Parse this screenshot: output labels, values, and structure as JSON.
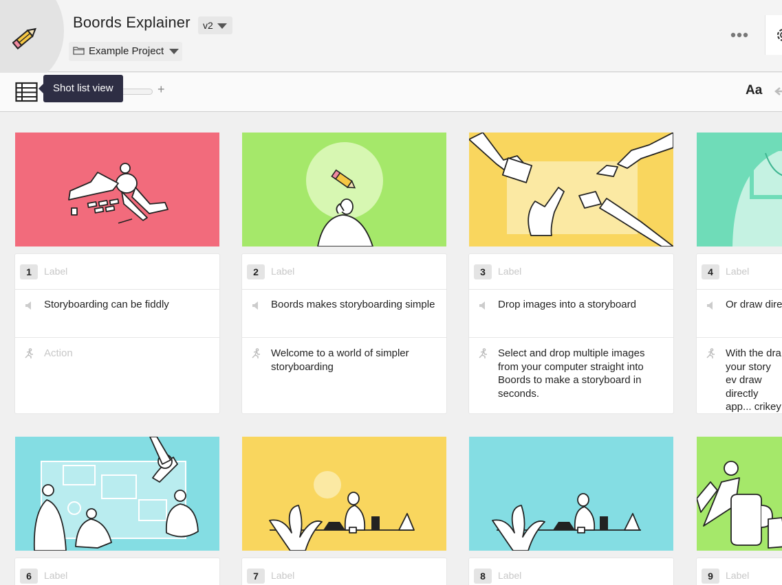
{
  "app": {
    "title": "Boords Explainer",
    "version": "v2",
    "project": "Example Project"
  },
  "toolbar": {
    "tooltip": "Shot list view",
    "zoom_plus": "+",
    "font_button": "Aa"
  },
  "colors": {
    "coral": "#f26b7c",
    "lime": "#a5e86a",
    "yellow": "#f9d65e",
    "mint": "#6fdcb8",
    "sky": "#84dde3",
    "tooltip_bg": "#2e2e44"
  },
  "frames": [
    {
      "number": "1",
      "label": "Label",
      "dialogue": "Storyboarding can be fiddly",
      "action": "Action",
      "action_placeholder": true,
      "color": "#f26b7c"
    },
    {
      "number": "2",
      "label": "Label",
      "dialogue": "Boords makes storyboarding simple",
      "action": "Welcome to a world of simpler storyboarding",
      "action_placeholder": false,
      "color": "#a5e86a"
    },
    {
      "number": "3",
      "label": "Label",
      "dialogue": "Drop images into a storyboard",
      "action": "Select and drop multiple images from your computer straight into Boords to make a storyboard in seconds.",
      "action_placeholder": false,
      "color": "#f9d65e"
    },
    {
      "number": "4",
      "label": "Label",
      "dialogue": "Or draw dire",
      "action": "With the dra your story ev draw directly app... crikey",
      "action_placeholder": false,
      "color": "#6fdcb8"
    },
    {
      "number": "6",
      "label": "Label",
      "color": "#84dde3"
    },
    {
      "number": "7",
      "label": "Label",
      "color": "#f9d65e"
    },
    {
      "number": "8",
      "label": "Label",
      "color": "#84dde3"
    },
    {
      "number": "9",
      "label": "Label",
      "color": "#a5e86a"
    }
  ]
}
